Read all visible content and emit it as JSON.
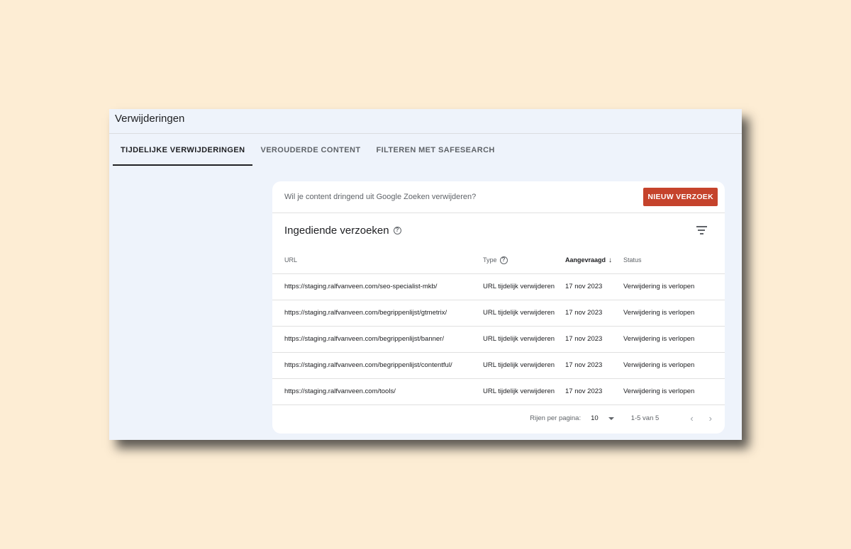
{
  "page": {
    "title": "Verwijderingen"
  },
  "tabs": [
    {
      "label": "TIJDELIJKE VERWIJDERINGEN",
      "active": true
    },
    {
      "label": "VEROUDERDE CONTENT",
      "active": false
    },
    {
      "label": "FILTEREN MET SAFESEARCH",
      "active": false
    }
  ],
  "promo": {
    "text": "Wil je content dringend uit Google Zoeken verwijderen?",
    "button_label": "NIEUW VERZOEK",
    "button_color": "#c5432c"
  },
  "section": {
    "title": "Ingediende verzoeken",
    "help_icon": "help-circle-icon",
    "filter_icon": "filter-icon"
  },
  "table": {
    "columns": {
      "url": "URL",
      "type": "Type",
      "requested": "Aangevraagd",
      "status": "Status"
    },
    "sort_icon": "arrow-down-icon",
    "rows": [
      {
        "url": "https://staging.ralfvanveen.com/seo-specialist-mkb/",
        "type": "URL tijdelijk verwijderen",
        "date": "17 nov 2023",
        "status": "Verwijdering is verlopen"
      },
      {
        "url": "https://staging.ralfvanveen.com/begrippenlijst/gtmetrix/",
        "type": "URL tijdelijk verwijderen",
        "date": "17 nov 2023",
        "status": "Verwijdering is verlopen"
      },
      {
        "url": "https://staging.ralfvanveen.com/begrippenlijst/banner/",
        "type": "URL tijdelijk verwijderen",
        "date": "17 nov 2023",
        "status": "Verwijdering is verlopen"
      },
      {
        "url": "https://staging.ralfvanveen.com/begrippenlijst/contentful/",
        "type": "URL tijdelijk verwijderen",
        "date": "17 nov 2023",
        "status": "Verwijdering is verlopen"
      },
      {
        "url": "https://staging.ralfvanveen.com/tools/",
        "type": "URL tijdelijk verwijderen",
        "date": "17 nov 2023",
        "status": "Verwijdering is verlopen"
      }
    ]
  },
  "pager": {
    "rows_label": "Rijen per pagina:",
    "rows_value": "10",
    "range": "1-5 van 5",
    "prev": "‹",
    "next": "›"
  }
}
